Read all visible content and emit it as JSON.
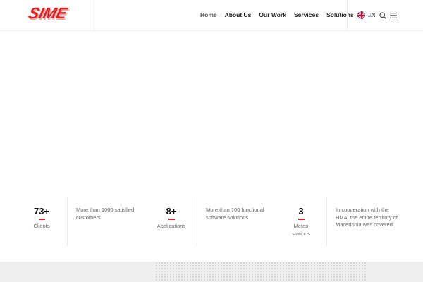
{
  "header": {
    "logo_text": "SIME",
    "nav": [
      "Home",
      "About Us",
      "Our Work",
      "Services",
      "Solutions"
    ],
    "language": "EN"
  },
  "stats": [
    {
      "value": "73+",
      "label": "Clients",
      "description": "More than 1000 satisfied customers"
    },
    {
      "value": "8+",
      "label": "Applications",
      "description": "More than 100 functional software solutions"
    },
    {
      "value": "3",
      "label": "Meteo stations",
      "description": "In cooperation with the HMA, the entire territory of Macedonia was covered"
    }
  ],
  "colors": {
    "accent": "#dd2222",
    "band": "#efefef"
  }
}
